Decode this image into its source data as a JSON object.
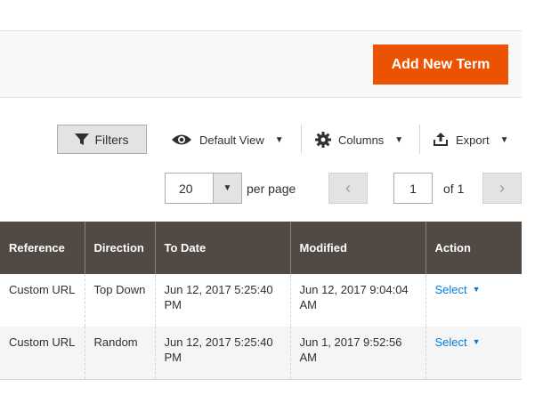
{
  "header": {
    "add_button_label": "Add New Term"
  },
  "toolbar": {
    "filters_label": "Filters",
    "view_label": "Default View",
    "columns_label": "Columns",
    "export_label": "Export"
  },
  "pagination": {
    "per_page_value": "20",
    "per_page_label": "per page",
    "current_page": "1",
    "of_label": "of 1",
    "prev_icon": "‹",
    "next_icon": "›"
  },
  "table": {
    "columns": [
      "Reference",
      "Direction",
      "To Date",
      "Modified",
      "Action"
    ],
    "rows": [
      {
        "reference": "Custom URL",
        "direction": "Top Down",
        "to_date": "Jun 12, 2017 5:25:40 PM",
        "modified": "Jun 12, 2017 9:04:04 AM",
        "action": "Select"
      },
      {
        "reference": "Custom URL",
        "direction": "Random",
        "to_date": "Jun 12, 2017 5:25:40 PM",
        "modified": "Jun 1, 2017 9:52:56 AM",
        "action": "Select"
      }
    ]
  },
  "colors": {
    "accent": "#eb5202",
    "header_bg": "#514943",
    "link": "#007bdb"
  }
}
